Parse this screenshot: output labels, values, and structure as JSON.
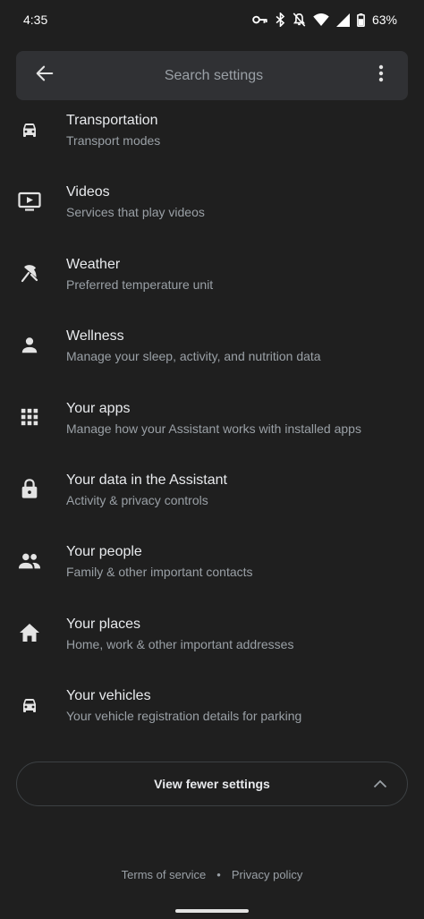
{
  "status_bar": {
    "time": "4:35",
    "battery": "63%",
    "icons": [
      "vpn-key-icon",
      "bluetooth-icon",
      "notifications-off-icon",
      "wifi-icon",
      "signal-icon",
      "battery-icon"
    ]
  },
  "search": {
    "placeholder": "Search settings",
    "value": "",
    "back_icon": "arrow-back-icon",
    "more_icon": "more-vert-icon"
  },
  "settings": [
    {
      "title": "Transportation",
      "subtitle": "Transport modes",
      "icon": "car-icon"
    },
    {
      "title": "Videos",
      "subtitle": "Services that play videos",
      "icon": "video-icon"
    },
    {
      "title": "Weather",
      "subtitle": "Preferred temperature unit",
      "icon": "umbrella-icon"
    },
    {
      "title": "Wellness",
      "subtitle": "Manage your sleep, activity, and nutrition data",
      "icon": "person-icon"
    },
    {
      "title": "Your apps",
      "subtitle": "Manage how your Assistant works with installed apps",
      "icon": "apps-grid-icon"
    },
    {
      "title": "Your data in the Assistant",
      "subtitle": "Activity & privacy controls",
      "icon": "lock-icon"
    },
    {
      "title": "Your people",
      "subtitle": "Family & other important contacts",
      "icon": "people-icon"
    },
    {
      "title": "Your places",
      "subtitle": "Home, work & other important addresses",
      "icon": "home-icon"
    },
    {
      "title": "Your vehicles",
      "subtitle": "Your vehicle registration details for parking",
      "icon": "car-icon"
    }
  ],
  "view_fewer": {
    "label": "View fewer settings",
    "icon": "chevron-up-icon"
  },
  "footer": {
    "terms": "Terms of service",
    "separator": "•",
    "privacy": "Privacy policy"
  },
  "colors": {
    "background": "#1f1f1f",
    "search_bar": "#303134",
    "primary_text": "#e8eaed",
    "secondary_text": "#9aa0a6"
  }
}
